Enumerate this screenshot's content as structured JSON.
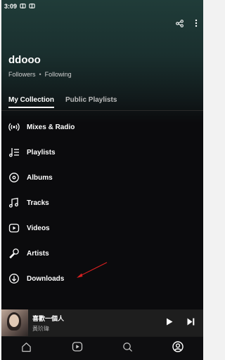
{
  "status_bar": {
    "time": "3:09",
    "notification_icons": [
      "app-notification-icon",
      "app-notification-icon"
    ]
  },
  "header": {
    "actions": [
      "share-icon",
      "more-options-icon"
    ]
  },
  "profile": {
    "name": "ddooo",
    "followers_label": "Followers",
    "separator": "•",
    "following_label": "Following"
  },
  "tabs": [
    {
      "label": "My Collection",
      "active": true
    },
    {
      "label": "Public Playlists",
      "active": false
    }
  ],
  "menu": [
    {
      "label": "Mixes & Radio",
      "icon": "radio-icon"
    },
    {
      "label": "Playlists",
      "icon": "playlist-icon"
    },
    {
      "label": "Albums",
      "icon": "album-icon"
    },
    {
      "label": "Tracks",
      "icon": "music-note-icon"
    },
    {
      "label": "Videos",
      "icon": "video-icon"
    },
    {
      "label": "Artists",
      "icon": "microphone-icon"
    },
    {
      "label": "Downloads",
      "icon": "download-icon"
    }
  ],
  "now_playing": {
    "title": "喜歡一個人",
    "artist": "黃玠瑋"
  },
  "bottom_nav": [
    {
      "name": "home",
      "icon": "home-icon"
    },
    {
      "name": "videos",
      "icon": "play-circle-icon"
    },
    {
      "name": "search",
      "icon": "search-icon"
    },
    {
      "name": "profile",
      "icon": "profile-icon",
      "active": true
    }
  ],
  "colors": {
    "background": "#0b0b0d",
    "hero_gradient_top": "#203c39",
    "annotation_arrow": "#d42020",
    "player_bg": "#1e1e1e"
  }
}
